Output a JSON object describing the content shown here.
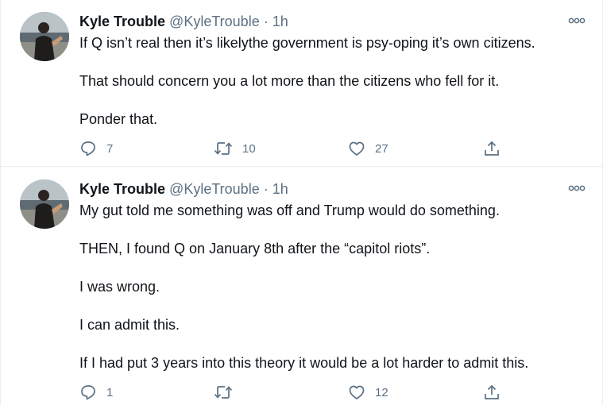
{
  "tweets": [
    {
      "author": {
        "name": "Kyle Trouble",
        "handle": "@KyleTrouble",
        "dot": "·",
        "time": "1h",
        "avatar_icon": "profile-photo"
      },
      "paragraphs": [
        "If Q isn’t real then it’s likelythe government is psy-oping it’s own citizens.",
        "That should concern you a lot more than the citizens who fell for it.",
        "Ponder that."
      ],
      "actions": {
        "reply_count": "7",
        "retweet_count": "10",
        "like_count": "27"
      }
    },
    {
      "author": {
        "name": "Kyle Trouble",
        "handle": "@KyleTrouble",
        "dot": "·",
        "time": "1h",
        "avatar_icon": "profile-photo"
      },
      "paragraphs": [
        "My gut told me something was off and Trump would do something.",
        "THEN, I found Q on January 8th after the “capitol riots”.",
        "I was wrong.",
        "I can admit this.",
        "If I had put 3 years into this theory it would be a lot harder to admit this."
      ],
      "actions": {
        "reply_count": "1",
        "retweet_count": "",
        "like_count": "12"
      }
    }
  ],
  "icons": [
    "more-icon",
    "reply-icon",
    "retweet-icon",
    "like-icon",
    "share-icon"
  ],
  "colors": {
    "text": "#0f1419",
    "secondary": "#5b7083",
    "divider": "#ebeef0"
  }
}
